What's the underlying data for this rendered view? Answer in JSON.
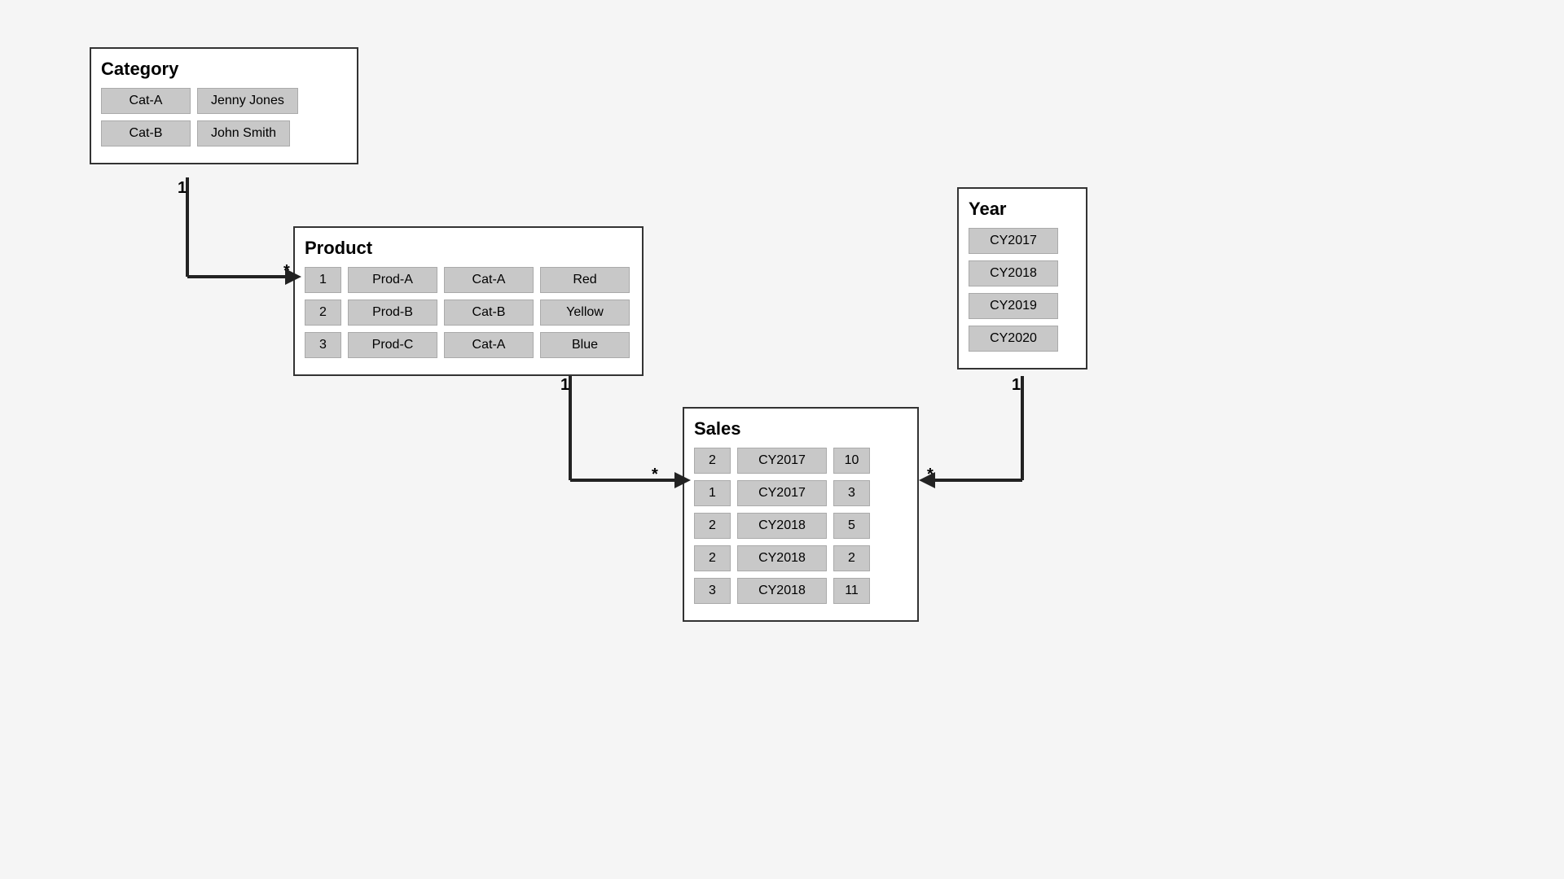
{
  "category": {
    "title": "Category",
    "rows": [
      [
        "Cat-A",
        "Jenny Jones"
      ],
      [
        "Cat-B",
        "John Smith"
      ]
    ]
  },
  "product": {
    "title": "Product",
    "rows": [
      [
        "1",
        "Prod-A",
        "Cat-A",
        "Red"
      ],
      [
        "2",
        "Prod-B",
        "Cat-B",
        "Yellow"
      ],
      [
        "3",
        "Prod-C",
        "Cat-A",
        "Blue"
      ]
    ]
  },
  "year": {
    "title": "Year",
    "rows": [
      [
        "CY2017"
      ],
      [
        "CY2018"
      ],
      [
        "CY2019"
      ],
      [
        "CY2020"
      ]
    ]
  },
  "sales": {
    "title": "Sales",
    "rows": [
      [
        "2",
        "CY2017",
        "10"
      ],
      [
        "1",
        "CY2017",
        "3"
      ],
      [
        "2",
        "CY2018",
        "5"
      ],
      [
        "2",
        "CY2018",
        "2"
      ],
      [
        "3",
        "CY2018",
        "11"
      ]
    ]
  },
  "labels": {
    "one1": "1",
    "star1": "*",
    "one2": "1",
    "star2": "*",
    "one3": "1",
    "star3": "*"
  }
}
